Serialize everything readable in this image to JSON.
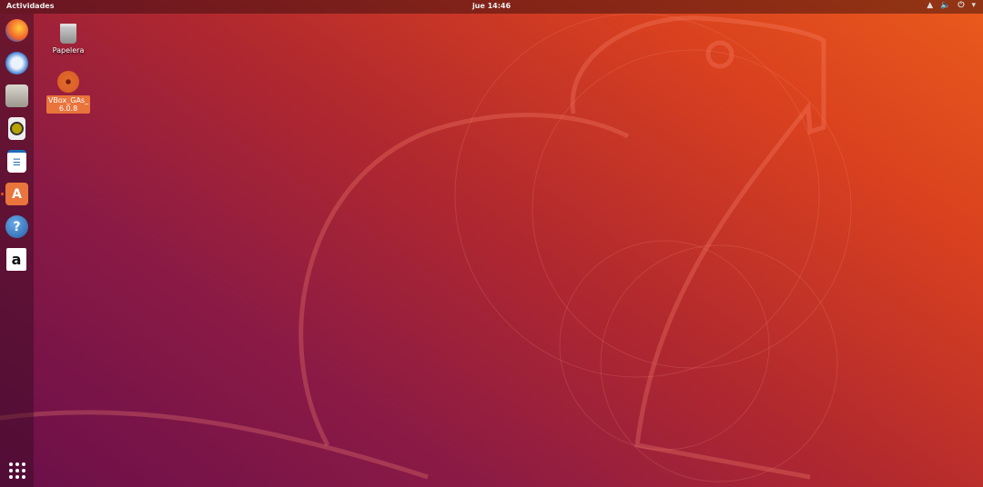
{
  "topbar": {
    "activities": "Actividades",
    "clock": "jue 14:46",
    "tray_icons": [
      "network-icon",
      "volume-icon",
      "power-icon",
      "chevron-down-icon"
    ]
  },
  "dock": {
    "items": [
      {
        "name": "firefox",
        "running": false
      },
      {
        "name": "thunderbird",
        "running": false
      },
      {
        "name": "files",
        "running": false
      },
      {
        "name": "rhythmbox",
        "running": false
      },
      {
        "name": "libreoffice-writer",
        "running": false
      },
      {
        "name": "ubuntu-software",
        "running": true
      },
      {
        "name": "help",
        "running": false
      },
      {
        "name": "amazon",
        "running": false
      }
    ],
    "help_glyph": "?",
    "amazon_glyph": "a",
    "software_glyph": "A"
  },
  "desktop": {
    "icons": [
      {
        "label": "Papelera"
      },
      {
        "label": "VBox_GAs_ 6.0.8",
        "selected": true
      }
    ]
  },
  "colors": {
    "accent": "#e95420",
    "selection": "#e9743c"
  }
}
